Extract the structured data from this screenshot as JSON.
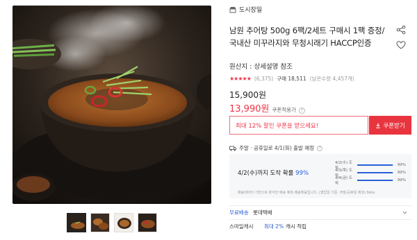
{
  "store": {
    "name": "도시장일",
    "icon": "store-icon"
  },
  "product": {
    "title": "남원 추어탕 500g 6팩/2세트 구매시 1팩 증정/국내산 미꾸라지와 무청시래기 HACCP인증",
    "origin": "원산지 : 상세설명 참조",
    "rating_stars": "★★★★★",
    "review_count": "(6,375)",
    "purchase_label": "구매 18,511",
    "purchase_sub": "(남은수량 4,457개)",
    "price_original": "15,900원",
    "price_sale": "13,990원",
    "price_sale_tag": "쿠폰적용가",
    "help_mark": "?"
  },
  "coupon": {
    "text": "최대 12% 할인 쿠폰을 받으세요!",
    "button": "쿠폰받기",
    "button_icon": "download-icon"
  },
  "shipping": {
    "summary": "주말 · 공휴일로 4/1(화) 출발 예정",
    "help_mark": "?",
    "forecast": {
      "headline_prefix": "4/2(수)까지 도착 확률",
      "headline_pct": "99%",
      "rows": [
        {
          "label": "4/2(수) 도착",
          "value": "99%",
          "fill": 0.99
        },
        {
          "label": "4/3(목) 도착",
          "value": "99%",
          "fill": 0.99
        },
        {
          "label": "4/4(금) 도착",
          "value": "99%",
          "fill": 0.99
        }
      ],
      "note": "배송데이터 기반으로 분석한 배송 예측 배송확률입니다. (영업일 기준, 주말/공휴일 제외) Beta"
    }
  },
  "rows": {
    "delivery_key": "무료배송",
    "delivery_value": "롯데택배",
    "cash_key": "스마일캐시",
    "cash_highlight": "최대 2%",
    "cash_value": "캐시 적립"
  },
  "colors": {
    "accent_red": "#f03246",
    "button_red": "#e8343e",
    "accent_blue": "#2860d6"
  }
}
